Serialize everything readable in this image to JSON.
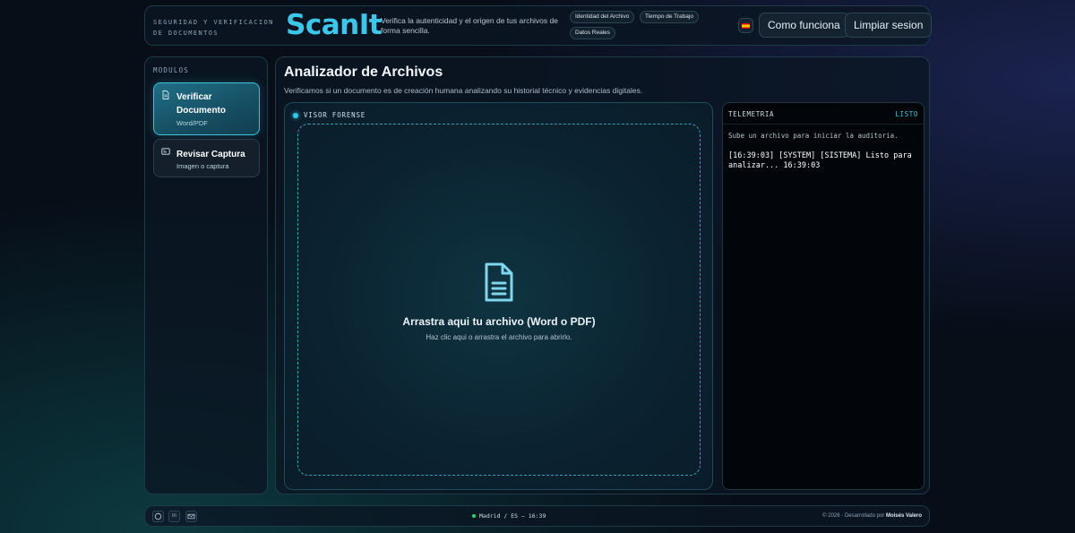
{
  "header": {
    "tagline": "SEGURIDAD Y VERIFICACION DE DOCUMENTOS",
    "brand": "ScanIt",
    "description": "Verifica la autenticidad y el origen de tus archivos de forma sencilla.",
    "chips": [
      "Identidad del Archivo",
      "Tiempo de Trabajo",
      "Datos Reales"
    ],
    "how_it_works_label": "Como funciona",
    "clear_session_label": "Limpiar sesion",
    "flag_icon": "spain-flag-icon"
  },
  "sidebar": {
    "title": "MODULOS",
    "modules": [
      {
        "title": "Verificar Documento",
        "subtitle": "Word/PDF",
        "icon": "document-icon",
        "active": true
      },
      {
        "title": "Revisar Captura",
        "subtitle": "Imagen o captura",
        "icon": "image-icon",
        "active": false
      }
    ]
  },
  "main": {
    "title": "Analizador de Archivos",
    "subtitle": "Verificamos si un documento es de creación humana analizando su historial técnico y evidencias digitales.",
    "viewer": {
      "label": "VISOR FORENSE",
      "drop_title": "Arrastra aqui tu archivo (Word o PDF)",
      "drop_subtitle": "Haz clic aqui o arrastra el archivo para abrirlo."
    },
    "telemetry": {
      "title": "TELEMETRIA",
      "status": "LISTO",
      "hint": "Sube un archivo para iniciar la auditoria.",
      "log": "[16:39:03] [SYSTEM] [SISTEMA] Listo para analizar... 16:39:03"
    }
  },
  "footer": {
    "icons": [
      "github-icon",
      "linkedin-icon",
      "mail-icon"
    ],
    "location": "Madrid / ES — 16:39",
    "copyright_prefix": "© 2026 · Desarrollado por",
    "author": "Moisés Valero"
  },
  "colors": {
    "accent": "#3ec6ea",
    "background": "#070e18",
    "status_ok": "#2bd47a"
  }
}
